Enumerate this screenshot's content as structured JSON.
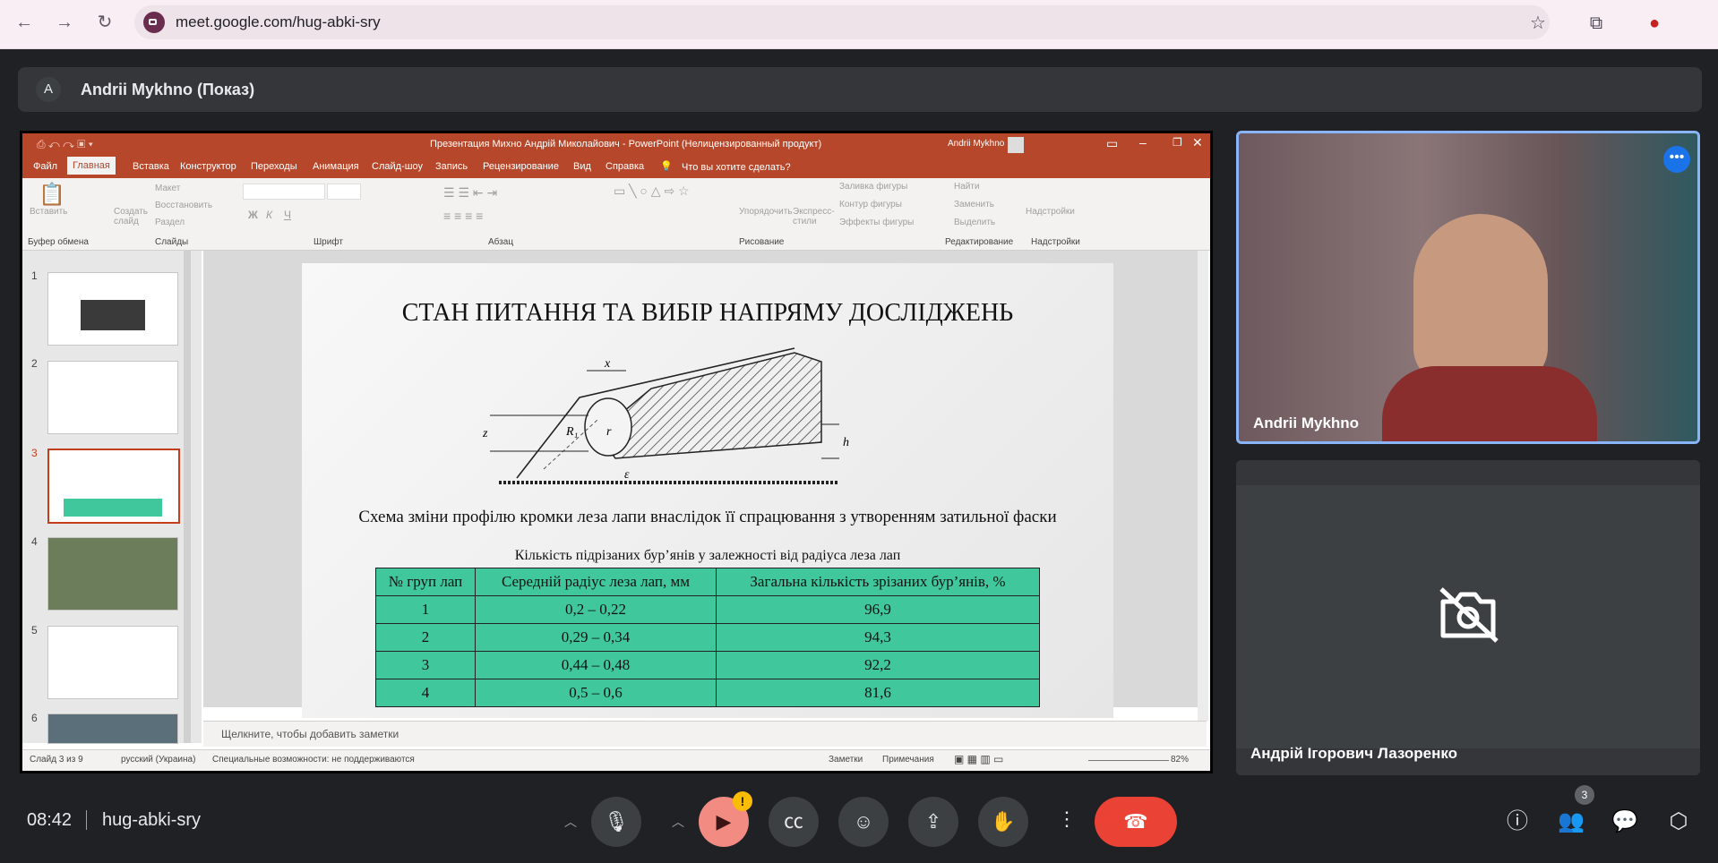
{
  "browser": {
    "url": "meet.google.com/hug-abki-sry",
    "icons": [
      "back-icon",
      "forward-icon",
      "reload-icon",
      "star-icon",
      "extensions-icon",
      "profile-icon"
    ]
  },
  "presenter": {
    "avatar_letter": "A",
    "name": "Andrii Mykhno (Показ)"
  },
  "powerpoint": {
    "window_title": "Презентация Михно Андрій Миколайович  -  PowerPoint (Нелицензированный продукт)",
    "user": "Andrii Mykhno",
    "tabs": [
      "Файл",
      "Главная",
      "Вставка",
      "Конструктор",
      "Переходы",
      "Анимация",
      "Слайд-шоу",
      "Запись",
      "Рецензирование",
      "Вид",
      "Справка"
    ],
    "active_tab": "Главная",
    "tell_me": "Что вы хотите сделать?",
    "groups": [
      "Буфер обмена",
      "Слайды",
      "Шрифт",
      "Абзац",
      "Рисование",
      "Редактирование",
      "Надстройки"
    ],
    "ribbon": {
      "paste": "Вставить",
      "new_slide": "Создать слайд",
      "layout": "Макет",
      "reset": "Восстановить",
      "section": "Раздел",
      "arrange": "Упорядочить",
      "quick_styles": "Экспресс-стили",
      "shape_fill": "Заливка фигуры",
      "shape_outline": "Контур фигуры",
      "shape_effects": "Эффекты фигуры",
      "find": "Найти",
      "replace": "Заменить",
      "select": "Выделить",
      "addins": "Надстройки"
    },
    "thumb_numbers": [
      "1",
      "2",
      "3",
      "4",
      "5",
      "6"
    ],
    "active_slide": "3",
    "notes_placeholder": "Щелкните, чтобы добавить заметки",
    "status": {
      "slide": "Слайд 3 из 9",
      "language": "русский (Украина)",
      "accessibility": "Специальные возможности: не поддерживаются",
      "notes": "Заметки",
      "comments": "Примечания",
      "zoom": "82%"
    }
  },
  "slide": {
    "title": "СТАН ПИТАННЯ ТА ВИБІР НАПРЯМУ ДОСЛІДЖЕНЬ",
    "diagram_labels": {
      "x": "x",
      "r1": "R₁",
      "r": "r",
      "z": "z",
      "h": "h",
      "e": "ε"
    },
    "caption": "Схема зміни профілю кромки леза лапи внаслідок її спрацювання з утворенням затильної фаски",
    "table_title": "Кількість підрізаних бур’янів у залежності від радіуса леза лап",
    "table": {
      "headers": [
        "№ груп лап",
        "Середній радіус леза лап, мм",
        "Загальна кількість зрізаних бур’янів, %"
      ],
      "rows": [
        [
          "1",
          "0,2 – 0,22",
          "96,9"
        ],
        [
          "2",
          "0,29 – 0,34",
          "94,3"
        ],
        [
          "3",
          "0,44 – 0,48",
          "92,2"
        ],
        [
          "4",
          "0,5 – 0,6",
          "81,6"
        ]
      ]
    }
  },
  "participants": [
    {
      "name": "Andrii Mykhno"
    },
    {
      "name": "Андрій Ігорович Лазоренко"
    }
  ],
  "bottom": {
    "time": "08:42",
    "meeting_code": "hug-abki-sry",
    "participant_count": "3",
    "warning_badge": "!"
  },
  "colors": {
    "end_call": "#ea4335",
    "accent_ppt": "#b7472a",
    "table_fill": "#40c89c"
  }
}
